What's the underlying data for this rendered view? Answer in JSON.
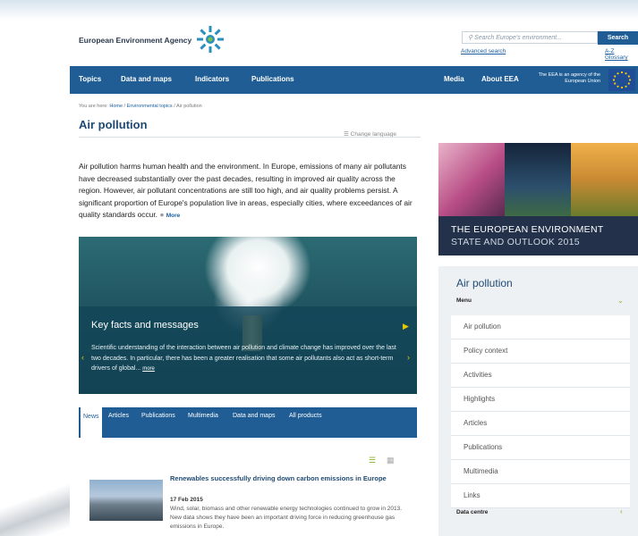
{
  "header": {
    "logo_text": "European Environment Agency",
    "search_placeholder": "Search Europe's environment...",
    "search_button": "Search",
    "advanced_search": "Advanced search",
    "az_glossary": "A-Z Glossary"
  },
  "nav": {
    "items": [
      "Topics",
      "Data and maps",
      "Indicators",
      "Publications"
    ],
    "right_items": [
      "Media",
      "About EEA"
    ],
    "agency_note": "The EEA is an agency of the European Union"
  },
  "breadcrumb": {
    "prefix": "You are here:",
    "home": "Home",
    "section": "Environmental topics",
    "current": "Air pollution"
  },
  "main": {
    "title": "Air pollution",
    "change_language": "Change language",
    "intro": "Air pollution harms human health and the environment. In Europe, emissions of many air pollutants have decreased substantially over the past decades, resulting in improved air quality across the region. However, air pollutant concentrations are still too high, and air quality problems persist. A significant proportion of Europe's population live in areas, especially cities, where exceedances of air quality standards occur.",
    "intro_more": "More"
  },
  "hero": {
    "title": "Key facts and messages",
    "text": "Scientific understanding of the interaction between air pollution and climate change has improved over the last two decades. In particular, there has been a greater realisation that some air pollutants also act as short-term drivers of global...",
    "more": "more"
  },
  "tabs": {
    "items": [
      "News",
      "Articles",
      "Publications",
      "Multimedia",
      "Data and maps",
      "All products"
    ],
    "active": "News"
  },
  "news": {
    "title": "Renewables successfully driving down carbon emissions in Europe",
    "date": "17 Feb 2015",
    "text": "Wind, solar, biomass and other renewable energy technologies continued to grow in 2013. New data shows they have been an important driving force in reducing greenhouse gas emissions in Europe."
  },
  "soer": {
    "line1": "THE EUROPEAN ENVIRONMENT",
    "line2": "STATE AND OUTLOOK 2015"
  },
  "sidebar": {
    "title": "Air pollution",
    "menu_label": "Menu",
    "items": [
      "Air pollution",
      "Policy context",
      "Activities",
      "Highlights",
      "Articles",
      "Publications",
      "Multimedia",
      "Links"
    ],
    "data_centre": "Data centre"
  },
  "colors": {
    "nav_blue": "#1f5d94",
    "title_blue": "#1f4a73",
    "accent_green": "#8cb11f",
    "accent_yellow": "#e6c700"
  }
}
